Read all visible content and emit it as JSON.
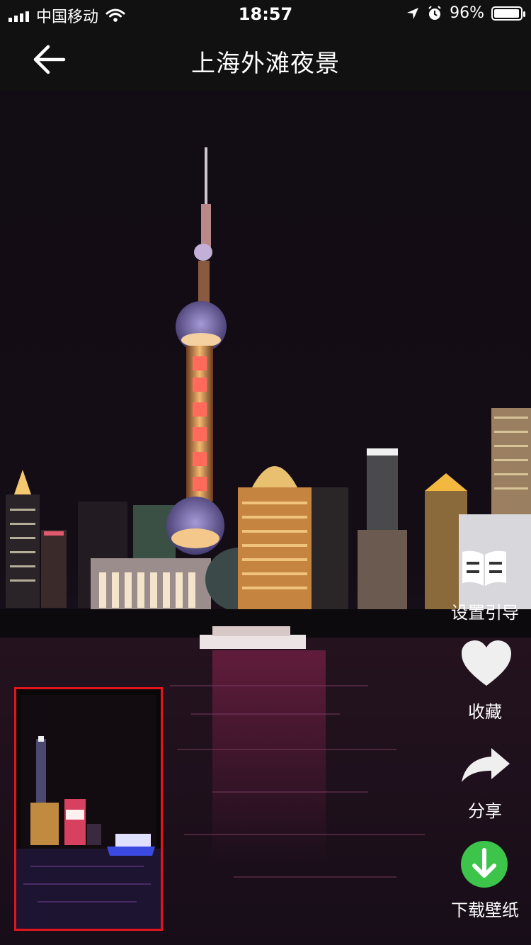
{
  "status_bar": {
    "carrier": "中国移动",
    "time": "18:57",
    "battery_percent": "96%",
    "battery_level": 0.96
  },
  "nav": {
    "title": "上海外滩夜景"
  },
  "actions": {
    "guide": "设置引导",
    "favorite": "收藏",
    "share": "分享",
    "download": "下载壁纸"
  },
  "colors": {
    "thumbnail_border": "#e0161c",
    "download_green": "#3cc54a"
  },
  "icons": {
    "back": "arrow-left-icon",
    "guide": "book-icon",
    "favorite": "heart-icon",
    "share": "share-arrow-icon",
    "download": "download-icon"
  }
}
